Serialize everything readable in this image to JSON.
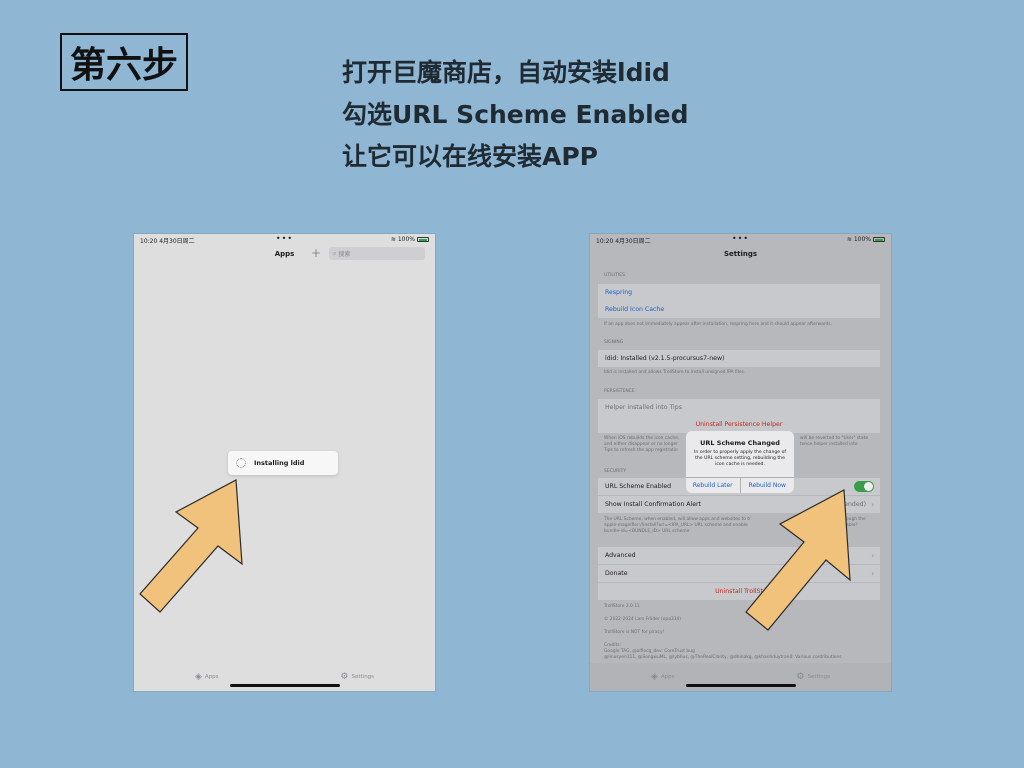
{
  "step_label": "第六步",
  "instructions": [
    "打开巨魔商店，自动安装ldid",
    "勾选URL Scheme Enabled",
    "让它可以在线安装APP"
  ],
  "left_screen": {
    "status": {
      "time": "10:20",
      "date": "4月30日周二",
      "battery": "100%"
    },
    "nav_title": "Apps",
    "add_symbol": "+",
    "search_placeholder": "搜索",
    "toast_text": "Installing ldid",
    "tabs": [
      {
        "label": "Apps",
        "icon": "apps-icon"
      },
      {
        "label": "Settings",
        "icon": "settings-icon"
      }
    ]
  },
  "right_screen": {
    "status": {
      "time": "10:20",
      "date": "4月30日周二",
      "battery": "100%"
    },
    "nav_title": "Settings",
    "utilities_header": "UTILITIES",
    "respring": "Respring",
    "rebuild_icon_cache": "Rebuild Icon Cache",
    "utilities_footer": "If an app does not immediately appear after installation, respring here and it should appear afterwards.",
    "signing_header": "SIGNING",
    "ldid_status": "ldid: Installed (v2.1.5-procursus7-new)",
    "signing_footer": "ldid is installed and allows TrollStore to install unsigned IPA files.",
    "persistence_header": "PERSISTENCE",
    "helper_installed": "Helper installed into Tips",
    "uninstall_persistence": "Uninstall Persistence Helper",
    "persistence_footer_1": "When iOS rebuilds the icon cache,",
    "persistence_footer_1b": "will be reverted to \"User\" state",
    "persistence_footer_2": "and either disappear or no longer",
    "persistence_footer_2b": "tence helper installed into",
    "persistence_footer_3": "Tips to refresh the app registratio",
    "security_header": "SECURITY",
    "url_scheme": "URL Scheme Enabled",
    "url_scheme_on": true,
    "show_install_alert": "Show Install Confirmation Alert",
    "show_install_alert_value": "nended)",
    "security_footer_1": "The URL Scheme, when enabled, will allow apps and websites to tr",
    "security_footer_1b": "ough the",
    "security_footer_2": "apple-magnifier://install?url=<IPA_URL> URL scheme and enable",
    "security_footer_2b": "able?",
    "security_footer_3": "bundle-id=<BUNDLE_ID> URL scheme",
    "advanced": "Advanced",
    "donate": "Donate",
    "uninstall_trollstore": "Uninstall TrollSt",
    "version": "TrollStore 2.0.11",
    "copyright": "© 2022-2024 Lars Fröder (opa334)",
    "piracy": "TrollStore is NOT for piracy!",
    "credits_header": "Credits:",
    "credits_line1": "Google TAG, @alfiecg_dev: CoreTrust bug",
    "credits_line2": "@linusyen111, @SongwuML, @lybhus, @TheRealClarity, @dhinakg, @khanhduytran0: Various contributions",
    "alert": {
      "title": "URL Scheme Changed",
      "message": "In order to properly apply the change of the URL scheme setting, rebuilding the icon cache is needed.",
      "button_left": "Rebuild Later",
      "button_right": "Rebuild Now"
    },
    "tabs": [
      {
        "label": "Apps",
        "icon": "apps-icon"
      },
      {
        "label": "Settings",
        "icon": "settings-icon"
      }
    ]
  },
  "colors": {
    "background": "#8fb7d4",
    "arrow_fill": "#f0c27b",
    "link_blue": "#1b5fc7",
    "destructive_red": "#c4251d",
    "toggle_green": "#3a9d4a"
  }
}
